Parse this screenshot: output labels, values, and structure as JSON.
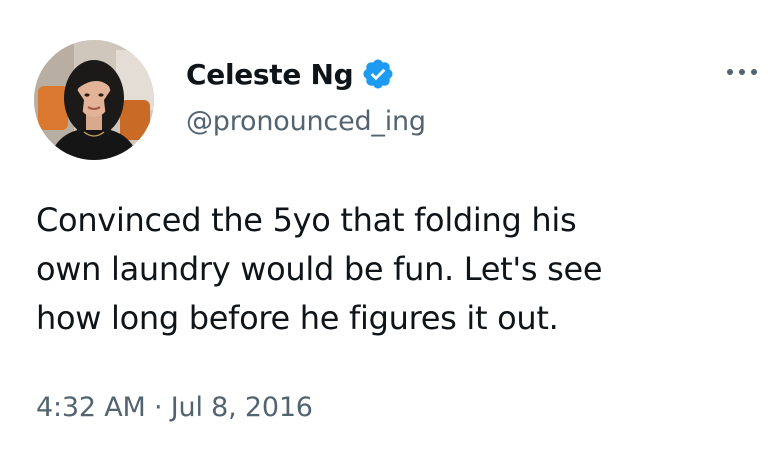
{
  "author": {
    "display_name": "Celeste Ng",
    "handle": "@pronounced_ing",
    "verified": true
  },
  "tweet": {
    "text_lines": [
      "Convinced the 5yo that folding his",
      "own laundry would be fun. Let's see",
      "how long before he figures it out."
    ],
    "time": "4:32 AM",
    "separator": "·",
    "date": "Jul 8, 2016"
  },
  "icons": {
    "verified": "verified-badge-icon",
    "more": "more-horizontal-icon"
  },
  "colors": {
    "text_primary": "#0f1419",
    "text_secondary": "#536471",
    "verified_blue": "#1d9bf0",
    "background": "#ffffff"
  }
}
